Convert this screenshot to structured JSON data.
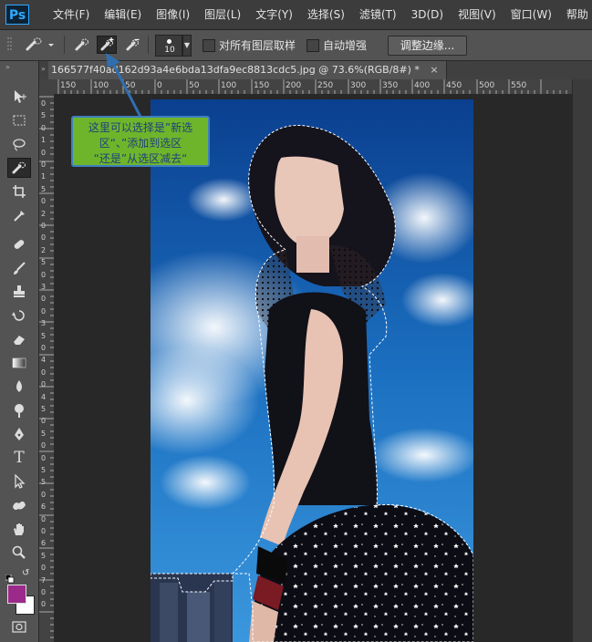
{
  "app": {
    "logo": "Ps"
  },
  "menu": [
    "文件(F)",
    "编辑(E)",
    "图像(I)",
    "图层(L)",
    "文字(Y)",
    "选择(S)",
    "滤镜(T)",
    "3D(D)",
    "视图(V)",
    "窗口(W)",
    "帮助"
  ],
  "options": {
    "brush_size": "10",
    "sample_all_layers": "对所有图层取样",
    "auto_enhance": "自动增强",
    "refine_edge": "调整边缘..."
  },
  "document": {
    "tab_title": "166577f40ad162d93a4e6bda13dfa9ec8813cdc5.jpg @ 73.6%(RGB/8#) *",
    "close_symbol": "×"
  },
  "ruler": {
    "h_ticks": [
      "150",
      "100",
      "50",
      "0",
      "50",
      "100",
      "150",
      "200",
      "250",
      "300",
      "350",
      "400",
      "450",
      "500",
      "550"
    ],
    "v_ticks": [
      "0",
      "5",
      "0",
      "1",
      "0",
      "0",
      "1",
      "5",
      "0",
      "2",
      "0",
      "0",
      "2",
      "5",
      "0",
      "3",
      "0",
      "0",
      "3",
      "5",
      "0",
      "4",
      "0",
      "0",
      "4",
      "5",
      "0",
      "5",
      "0",
      "0",
      "5",
      "5",
      "0",
      "6",
      "0",
      "0",
      "6",
      "5",
      "0",
      "7",
      "0",
      "0"
    ]
  },
  "annotation": {
    "lines": [
      "这里可以选择是”新选",
      "区“、”添加到选区",
      "“还是”从选区减去“"
    ]
  },
  "colors": {
    "foreground": "#9b2a8b",
    "background": "#ffffff",
    "callout_bg": "#6fb52c",
    "callout_border": "#3d7fbf",
    "arrow": "#2f6fb0"
  },
  "icons": {
    "tools": [
      "move-tool-icon",
      "marquee-tool-icon",
      "lasso-tool-icon",
      "quick-selection-tool-icon",
      "crop-tool-icon",
      "eyedropper-tool-icon",
      "healing-brush-tool-icon",
      "brush-tool-icon",
      "clone-stamp-tool-icon",
      "history-brush-tool-icon",
      "eraser-tool-icon",
      "gradient-tool-icon",
      "blur-tool-icon",
      "dodge-tool-icon",
      "pen-tool-icon",
      "type-tool-icon",
      "path-selection-tool-icon",
      "custom-shape-tool-icon",
      "hand-tool-icon",
      "zoom-tool-icon"
    ]
  }
}
